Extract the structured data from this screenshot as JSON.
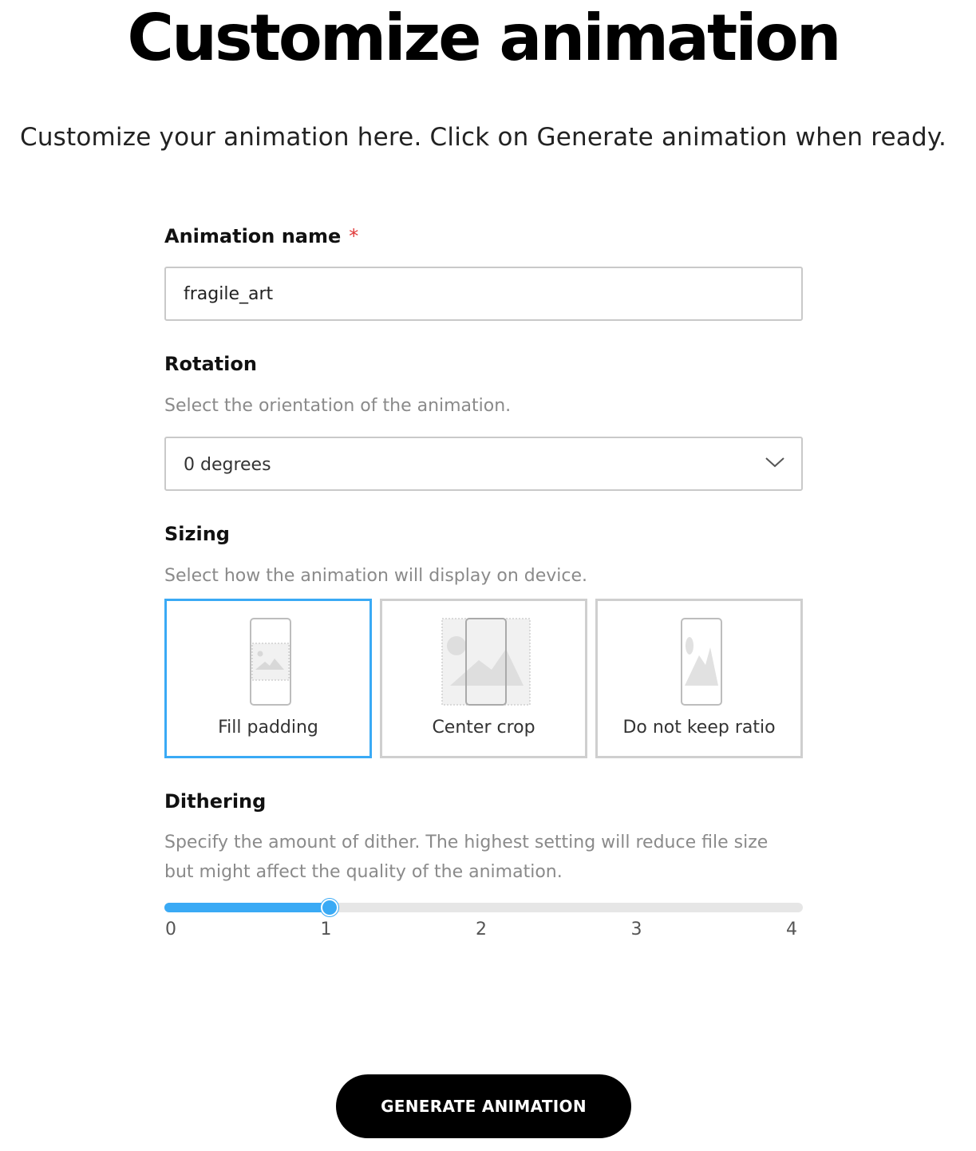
{
  "page": {
    "title": "Customize animation",
    "subtitle": "Customize your animation here. Click on Generate animation when ready."
  },
  "animation_name": {
    "label": "Animation name",
    "required_marker": "*",
    "value": "fragile_art"
  },
  "rotation": {
    "label": "Rotation",
    "helper": "Select the orientation of the animation.",
    "selected": "0 degrees",
    "icon": "chevron-down-icon"
  },
  "sizing": {
    "label": "Sizing",
    "helper": "Select how the animation will display on device.",
    "selected_option": "Fill padding",
    "options": [
      {
        "label": "Fill padding",
        "icon": "fill-padding-icon"
      },
      {
        "label": "Center crop",
        "icon": "center-crop-icon"
      },
      {
        "label": "Do not keep ratio",
        "icon": "do-not-keep-ratio-icon"
      }
    ]
  },
  "dithering": {
    "label": "Dithering",
    "helper_line1": "Specify the amount of dither. The highest setting will reduce file size",
    "helper_line2": "but might affect the quality of the animation.",
    "min": 0,
    "max": 4,
    "value": 1,
    "ticks": [
      "0",
      "1",
      "2",
      "3",
      "4"
    ]
  },
  "generate_button": {
    "label": "GENERATE ANIMATION"
  },
  "colors": {
    "accent": "#3aaaf5",
    "required": "#e03a3a",
    "button_bg": "#000000"
  }
}
